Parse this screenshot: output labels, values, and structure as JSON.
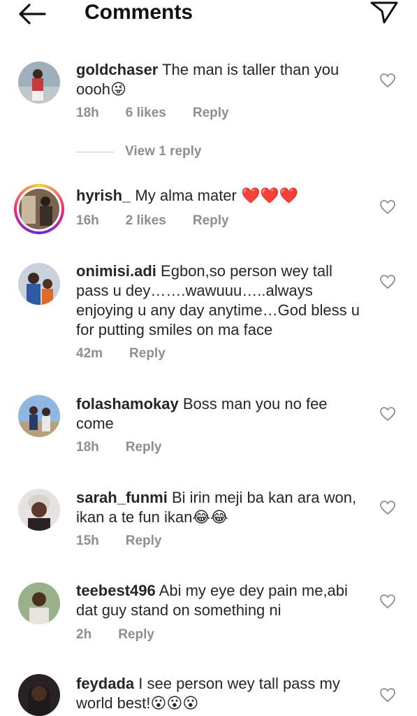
{
  "header": {
    "title": "Comments",
    "back_icon": "arrow-left-icon",
    "send_icon": "paper-plane-icon"
  },
  "comments": [
    {
      "username": "goldchaser",
      "text": "The man is taller than you oooh😜",
      "time": "18h",
      "likes": "6 likes",
      "reply": "Reply",
      "avatar_color": "#8a9aa6",
      "view_replies": "View 1 reply"
    },
    {
      "username": "hyrish_",
      "text": "My alma mater ❤️❤️❤️",
      "time": "16h",
      "likes": "2 likes",
      "reply": "Reply",
      "avatar_color": "#6b5a4a"
    },
    {
      "username": "onimisi.adi",
      "text": "Egbon,so person wey tall pass u dey…….wawuuu…..always enjoying u any day anytime…God bless u for putting smiles on ma face",
      "time": "42m",
      "reply": "Reply",
      "avatar_color": "#3c5a8a"
    },
    {
      "username": "folashamokay",
      "text": "Boss man you no fee come",
      "time": "18h",
      "reply": "Reply",
      "avatar_color": "#7ea7d4"
    },
    {
      "username": "sarah_funmi",
      "text": "Bi irin meji ba kan ara won, ikan a te fun ikan😂😂",
      "time": "15h",
      "reply": "Reply",
      "avatar_color": "#5a4a4a"
    },
    {
      "username": "teebest496",
      "text": "Abi my eye dey pain me,abi dat guy stand on something ni",
      "time": "2h",
      "reply": "Reply",
      "avatar_color": "#6a8a5a"
    },
    {
      "username": "feydada",
      "text": "I see person wey tall pass my world best!😮😮😮",
      "avatar_color": "#3a2a28"
    }
  ]
}
